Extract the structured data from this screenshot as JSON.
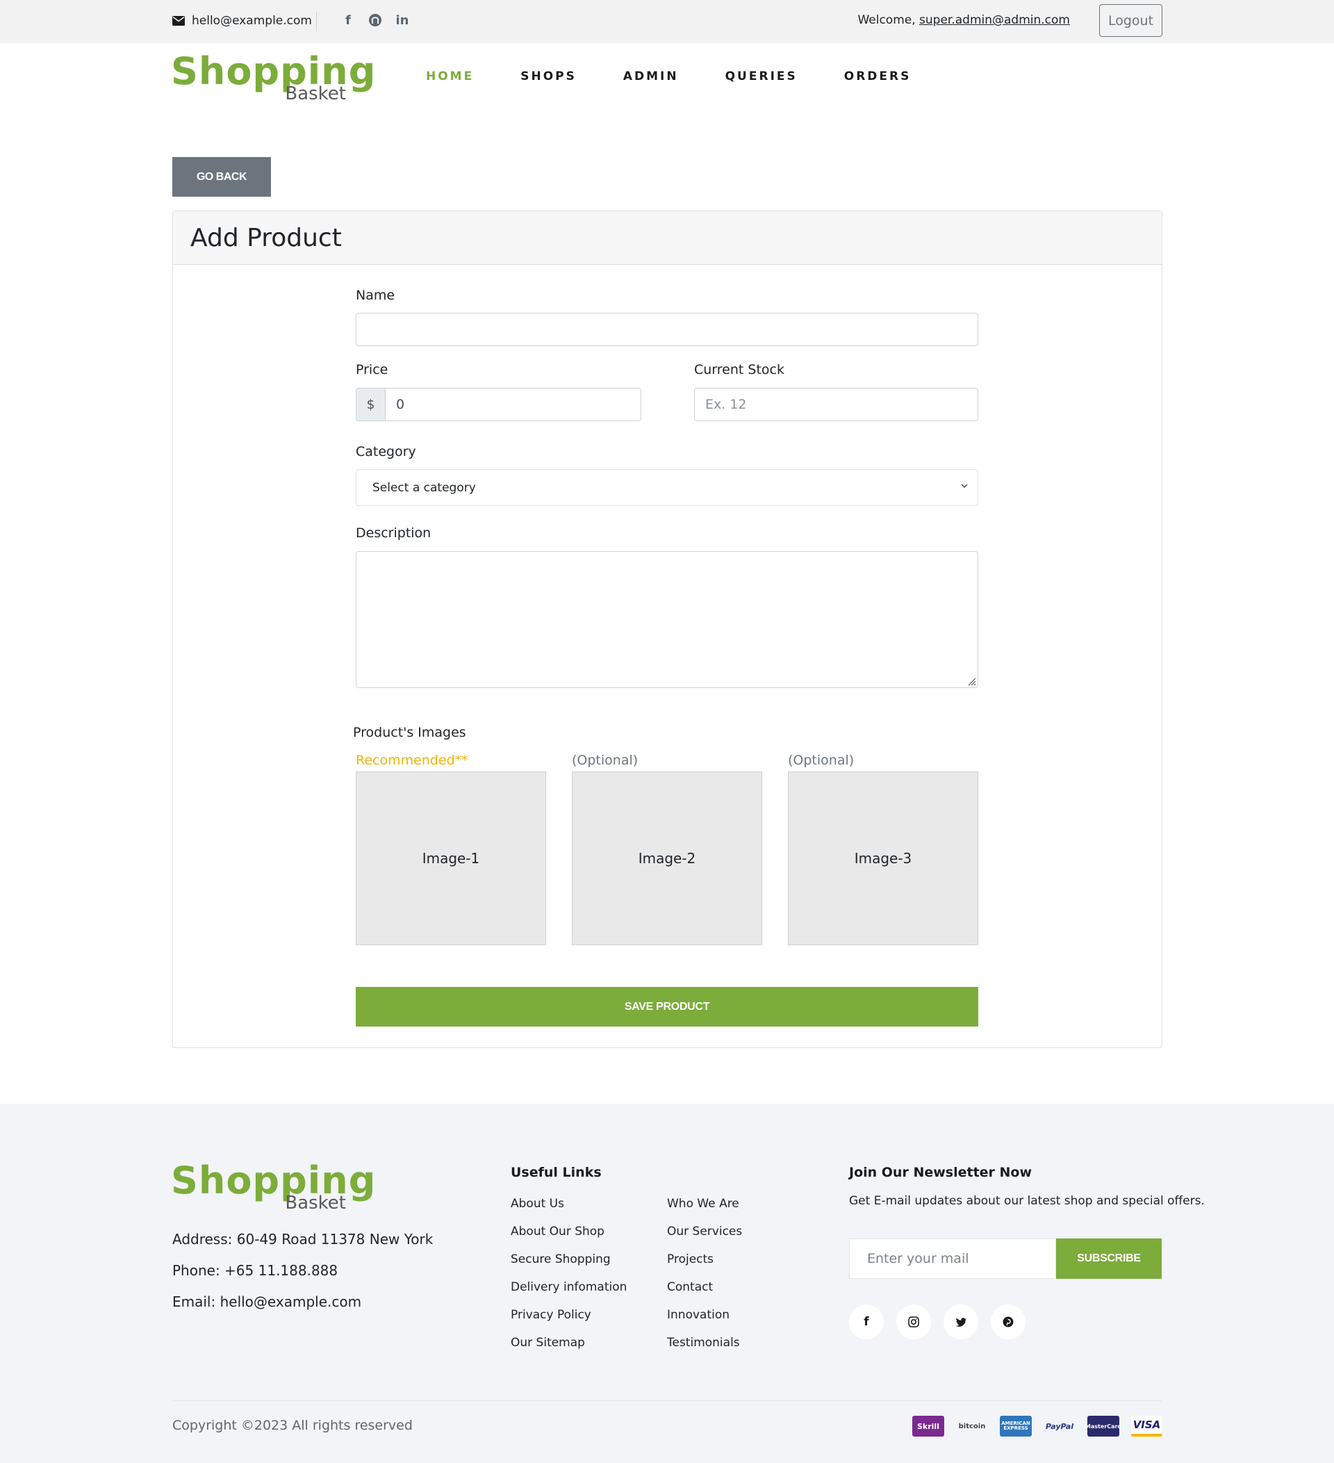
{
  "topbar": {
    "email": "hello@example.com",
    "welcome_prefix": "Welcome, ",
    "user_email": "super.admin@admin.com",
    "logout_label": "Logout"
  },
  "logo": {
    "line1": "Shopping",
    "line2": "Basket"
  },
  "nav": {
    "home": "HOME",
    "shops": "SHOPS",
    "admin": "ADMIN",
    "queries": "QUERIES",
    "orders": "ORDERS"
  },
  "goback_label": "GO BACK",
  "form": {
    "title": "Add Product",
    "name_label": "Name",
    "name_value": "",
    "price_label": "Price",
    "price_prefix": "$",
    "price_value": "0",
    "stock_label": "Current Stock",
    "stock_placeholder": "Ex. 12",
    "category_label": "Category",
    "category_selected": "Select a category",
    "description_label": "Description",
    "images_label": "Product's Images",
    "image_tags": [
      "Recommended**",
      "(Optional)",
      "(Optional)"
    ],
    "image_names": [
      "Image-1",
      "Image-2",
      "Image-3"
    ],
    "save_label": "SAVE PRODUCT"
  },
  "footer": {
    "address": "Address: 60-49 Road 11378 New York",
    "phone": "Phone: +65 11.188.888",
    "email": "Email: hello@example.com",
    "useful_links_title": "Useful Links",
    "links_col1": [
      "About Us",
      "About Our Shop",
      "Secure Shopping",
      "Delivery infomation",
      "Privacy Policy",
      "Our Sitemap"
    ],
    "links_col2": [
      "Who We Are",
      "Our Services",
      "Projects",
      "Contact",
      "Innovation",
      "Testimonials"
    ],
    "newsletter_title": "Join Our Newsletter Now",
    "newsletter_desc": "Get E-mail updates about our latest shop and special offers.",
    "newsletter_placeholder": "Enter your mail",
    "subscribe_label": "SUBSCRIBE",
    "social_icons": [
      "facebook-icon",
      "instagram-icon",
      "twitter-icon",
      "pinterest-icon"
    ],
    "copyright": "Copyright ©2023 All rights reserved",
    "payment_icons": [
      "Skrill",
      "bitcoin",
      "AMERICAN EXPRESS",
      "PayPal",
      "MasterCard",
      "VISA"
    ]
  },
  "colors": {
    "accent": "#7cac3a",
    "secondary": "#6c757d",
    "warning": "#f0b400",
    "topbar_bg": "#f2f2f2",
    "footer_bg": "#f2f4f8"
  }
}
